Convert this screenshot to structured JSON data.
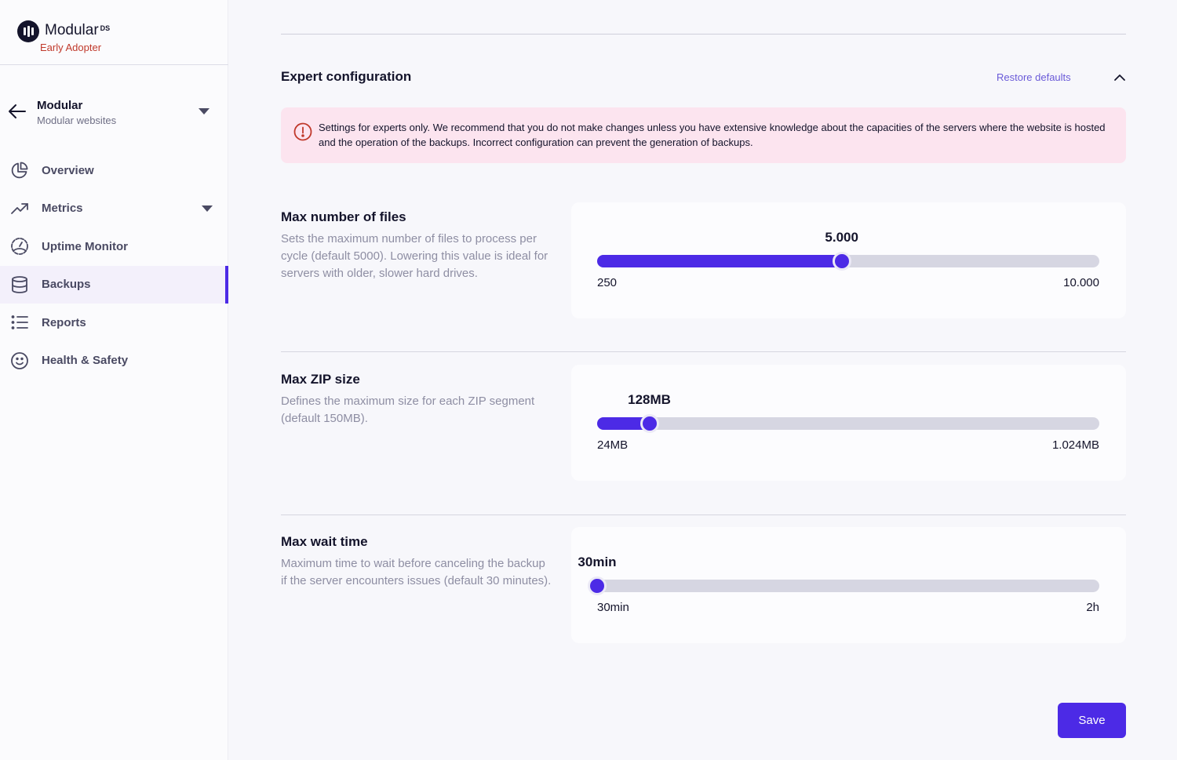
{
  "brand": {
    "name": "Modular",
    "superscript": "DS",
    "tagline": "Early Adopter"
  },
  "site_switcher": {
    "name": "Modular",
    "subtitle": "Modular websites"
  },
  "sidebar": {
    "items": [
      {
        "label": "Overview",
        "icon": "pie-chart-icon",
        "active": false
      },
      {
        "label": "Metrics",
        "icon": "trending-up-icon",
        "active": false,
        "has_submenu": true
      },
      {
        "label": "Uptime Monitor",
        "icon": "gauge-icon",
        "active": false
      },
      {
        "label": "Backups",
        "icon": "database-icon",
        "active": true
      },
      {
        "label": "Reports",
        "icon": "list-icon",
        "active": false
      },
      {
        "label": "Health & Safety",
        "icon": "smile-icon",
        "active": false
      }
    ]
  },
  "expert": {
    "title": "Expert configuration",
    "restore_label": "Restore defaults",
    "alert": "Settings for experts only. We recommend that you do not make changes unless you have extensive knowledge about the capacities of the servers where the website is hosted and the operation of the backups. Incorrect configuration can prevent the generation of backups."
  },
  "settings": [
    {
      "title": "Max number of files",
      "description": "Sets the maximum number of files to process per cycle (default 5000). Lowering this value is ideal for servers with older, slower hard drives.",
      "value_label": "5.000",
      "min_label": "250",
      "max_label": "10.000",
      "fraction": 0.487
    },
    {
      "title": "Max ZIP size",
      "description": "Defines the maximum size for each ZIP segment (default 150MB).",
      "value_label": "128MB",
      "min_label": "24MB",
      "max_label": "1.024MB",
      "fraction": 0.104
    },
    {
      "title": "Max wait time",
      "description": "Maximum time to wait before canceling the backup if the server encounters issues (default 30 minutes).",
      "value_label": "30min",
      "min_label": "30min",
      "max_label": "2h",
      "fraction": 0
    }
  ],
  "actions": {
    "save_label": "Save"
  },
  "colors": {
    "accent": "#4c2ae6",
    "alert_bg": "#fce4ef",
    "alert_icon": "#c0392b",
    "link": "#6a5ad8"
  }
}
